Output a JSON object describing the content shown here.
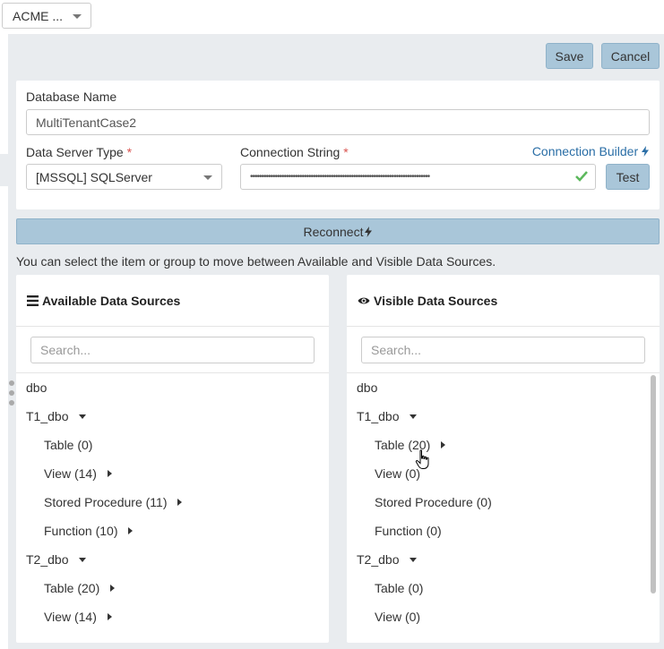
{
  "org": {
    "label": "ACME ..."
  },
  "toolbar": {
    "save_label": "Save",
    "cancel_label": "Cancel"
  },
  "form": {
    "database_name_label": "Database Name",
    "database_name_value": "MultiTenantCase2",
    "server_type_label": "Data Server Type",
    "server_type_value": "[MSSQL] SQLServer",
    "connection_string_label": "Connection String",
    "required_mark": "*",
    "connection_string_value": "••••••••••••••••••••••••••••••••••••••••••••••••••••••••••••••••••••••••••••••••",
    "connection_builder_label": "Connection Builder",
    "test_label": "Test"
  },
  "reconnect_label": "Reconnect",
  "hint": "You can select the item or group to move between Available and Visible Data Sources.",
  "available": {
    "title": "Available Data Sources",
    "search_placeholder": "Search...",
    "items": [
      {
        "label": "dbo",
        "level": 0,
        "arrow": "none"
      },
      {
        "label": "T1_dbo",
        "level": 0,
        "arrow": "down"
      },
      {
        "label": "Table (0)",
        "level": 1,
        "arrow": "none"
      },
      {
        "label": "View (14)",
        "level": 1,
        "arrow": "right"
      },
      {
        "label": "Stored Procedure (11)",
        "level": 1,
        "arrow": "right"
      },
      {
        "label": "Function (10)",
        "level": 1,
        "arrow": "right"
      },
      {
        "label": "T2_dbo",
        "level": 0,
        "arrow": "down"
      },
      {
        "label": "Table (20)",
        "level": 1,
        "arrow": "right"
      },
      {
        "label": "View (14)",
        "level": 1,
        "arrow": "right"
      }
    ]
  },
  "visible": {
    "title": "Visible Data Sources",
    "search_placeholder": "Search...",
    "items": [
      {
        "label": "dbo",
        "level": 0,
        "arrow": "none"
      },
      {
        "label": "T1_dbo",
        "level": 0,
        "arrow": "down"
      },
      {
        "label": "Table (20)",
        "level": 1,
        "arrow": "right"
      },
      {
        "label": "View (0)",
        "level": 1,
        "arrow": "none"
      },
      {
        "label": "Stored Procedure (0)",
        "level": 1,
        "arrow": "none"
      },
      {
        "label": "Function (0)",
        "level": 1,
        "arrow": "none"
      },
      {
        "label": "T2_dbo",
        "level": 0,
        "arrow": "down"
      },
      {
        "label": "Table (0)",
        "level": 1,
        "arrow": "none"
      },
      {
        "label": "View (0)",
        "level": 1,
        "arrow": "none"
      }
    ]
  },
  "colors": {
    "accent": "#2a6ea6",
    "button_bg": "#a9c6d9",
    "success": "#5cb85c",
    "required": "#d9534f"
  }
}
